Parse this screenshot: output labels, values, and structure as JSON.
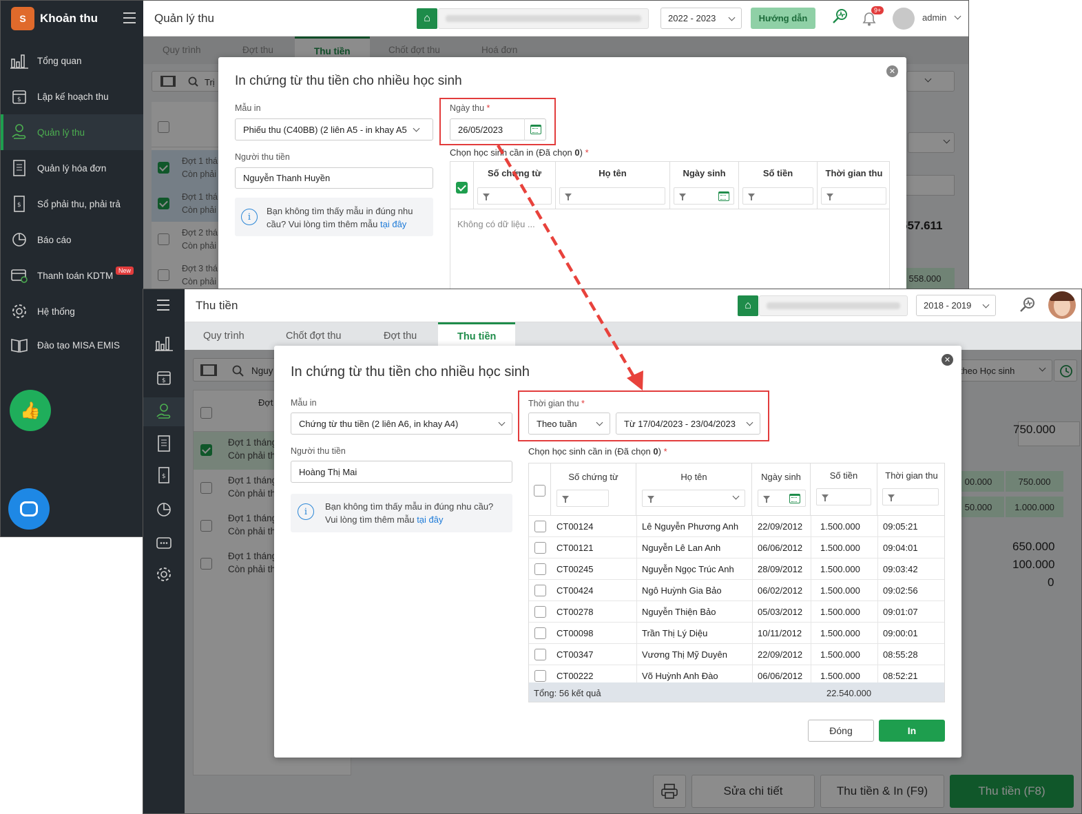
{
  "s1": {
    "sidebar": {
      "logo_text": "S",
      "title": "Khoản thu",
      "items": [
        {
          "label": "Tổng quan",
          "icon": "bar-chart-icon"
        },
        {
          "label": "Lập kế hoạch thu",
          "icon": "calendar-dollar-icon"
        },
        {
          "label": "Quản lý thu",
          "icon": "hand-coin-icon",
          "active": true
        },
        {
          "label": "Quản lý hóa đơn",
          "icon": "invoice-icon"
        },
        {
          "label": "Sổ phải thu, phải trả",
          "icon": "ledger-icon"
        },
        {
          "label": "Báo cáo",
          "icon": "pie-chart-icon"
        },
        {
          "label": "Thanh toán KDTM",
          "icon": "payment-card-icon",
          "badge": "New"
        },
        {
          "label": "Hệ thống",
          "icon": "gear-icon"
        },
        {
          "label": "Đào tạo MISA EMIS",
          "icon": "book-icon"
        }
      ]
    },
    "topbar": {
      "title": "Quản lý thu",
      "year": "2022 - 2023",
      "guide_label": "Hướng dẫn",
      "notif_badge": "9+",
      "user": "admin"
    },
    "tabs": [
      "Quy trình",
      "Đợt thu",
      "Thu tiền",
      "Chốt đợt thu",
      "Hoá đơn"
    ],
    "active_tab": "Thu tiền",
    "bg": {
      "search_prefix": "Trị",
      "rows": [
        {
          "l1": "Đợt 1 thá",
          "l2": "Còn phải"
        },
        {
          "l1": "Đợt 1 thá",
          "l2": "Còn phải"
        },
        {
          "l1": "Đợt 2 thá",
          "l2": "Còn phải"
        },
        {
          "l1": "Đợt 3 thá",
          "l2": "Còn phải"
        }
      ],
      "amount1": "557.611",
      "amount2": "558.000"
    },
    "dialog": {
      "title": "In chứng từ thu tiền cho nhiều học sinh",
      "template_label": "Mẫu in",
      "template_value": "Phiếu thu (C40BB) (2 liên A5 - in khay A5",
      "collector_label": "Người thu tiền",
      "collector_value": "Nguyễn Thanh Huyền",
      "info_text": "Bạn không tìm thấy mẫu in đúng nhu cầu? Vui lòng tìm thêm mẫu ",
      "info_link": "tại đây",
      "date_label": "Ngày thu",
      "date_value": "26/05/2023",
      "select_label": "Chọn học sinh cần in (Đã chọn ",
      "select_count": "0",
      "select_close": ")",
      "columns": [
        "Số chứng từ",
        "Họ tên",
        "Ngày sinh",
        "Số tiền",
        "Thời gian thu"
      ],
      "empty_text": "Không có dữ liệu ..."
    }
  },
  "s2": {
    "topbar": {
      "title": "Thu tiền",
      "year": "2018 - 2019"
    },
    "tabs": [
      "Quy trình",
      "Chốt đợt thu",
      "Đợt thu",
      "Thu tiền"
    ],
    "active_tab": "Thu tiền",
    "bg": {
      "search_prefix": "Nguy",
      "col_head": "Đợt",
      "view_select": "u theo Học sinh",
      "rows": [
        {
          "l1": "Đợt 1 tháng",
          "l2": "Còn phải th"
        },
        {
          "l1": "Đợt 1 tháng",
          "l2": "Còn phải th"
        },
        {
          "l1": "Đợt 1 tháng",
          "l2": "Còn phải th"
        },
        {
          "l1": "Đợt 1 tháng",
          "l2": "Còn phải th"
        }
      ],
      "amount_top": "750.000",
      "cell_a1": "00.000",
      "cell_a2": "750.000",
      "cell_b1": "50.000",
      "cell_b2": "1.000.000",
      "sum1": "650.000",
      "sum2": "100.000",
      "sum3": "0",
      "btn_edit": "Sửa chi tiết",
      "btn_collect_print": "Thu tiền & In (F9)",
      "btn_collect": "Thu tiền (F8)"
    },
    "dialog": {
      "title": "In chứng từ thu tiền cho nhiều học sinh",
      "template_label": "Mẫu in",
      "template_value": "Chứng từ thu tiền (2 liên A6, in khay A4)",
      "collector_label": "Người thu tiền",
      "collector_value": "Hoàng Thị Mai",
      "info_text": "Bạn không tìm thấy mẫu in đúng nhu cầu? Vui lòng tìm thêm mẫu ",
      "info_link": "tại đây",
      "time_label": "Thời gian thu",
      "period_value": "Theo tuần",
      "range_value": "Từ 17/04/2023 - 23/04/2023",
      "select_label": "Chọn học sinh cần in (Đã chọn ",
      "select_count": "0",
      "select_close": ")",
      "columns": [
        "Số chứng từ",
        "Họ tên",
        "Ngày sinh",
        "Số tiền",
        "Thời gian thu"
      ],
      "rows": [
        {
          "code": "CT00124",
          "name": "Lê Nguyễn Phương Anh",
          "dob": "22/09/2012",
          "amount": "1.500.000",
          "time": "09:05:21"
        },
        {
          "code": "CT00121",
          "name": "Nguyễn Lê Lan Anh",
          "dob": "06/06/2012",
          "amount": "1.500.000",
          "time": "09:04:01"
        },
        {
          "code": "CT00245",
          "name": "Nguyễn Ngọc Trúc Anh",
          "dob": "28/09/2012",
          "amount": "1.500.000",
          "time": "09:03:42"
        },
        {
          "code": "CT00424",
          "name": "Ngô Huỳnh Gia Bảo",
          "dob": "06/02/2012",
          "amount": "1.500.000",
          "time": "09:02:56"
        },
        {
          "code": "CT00278",
          "name": "Nguyễn Thiện Bảo",
          "dob": "05/03/2012",
          "amount": "1.500.000",
          "time": "09:01:07"
        },
        {
          "code": "CT00098",
          "name": "Trần Thị Lý Diệu",
          "dob": "10/11/2012",
          "amount": "1.500.000",
          "time": "09:00:01"
        },
        {
          "code": "CT00347",
          "name": "Vương Thị Mỹ Duyên",
          "dob": "22/09/2012",
          "amount": "1.500.000",
          "time": "08:55:28"
        },
        {
          "code": "CT00222",
          "name": "Võ Huỳnh Anh Đào",
          "dob": "06/06/2012",
          "amount": "1.500.000",
          "time": "08:52:21"
        }
      ],
      "total_label": "Tổng: 56 kết quả",
      "total_amount": "22.540.000",
      "btn_close": "Đóng",
      "btn_print": "In"
    }
  },
  "colors": {
    "brand_green": "#1e9e4e",
    "highlight_red": "#e23c3c",
    "sidebar_bg": "#23292f",
    "link_blue": "#1e7bd8"
  }
}
